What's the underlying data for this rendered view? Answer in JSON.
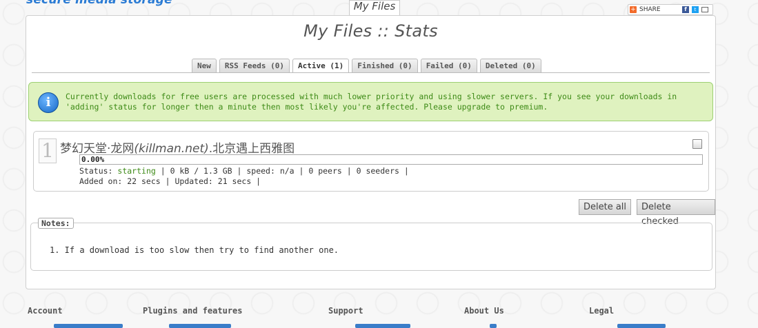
{
  "brand": {
    "tagline": "secure media storage"
  },
  "header": {
    "top_tab": "My Files",
    "share_label": "SHARE"
  },
  "page": {
    "title": "My Files :: Stats"
  },
  "tabs": [
    {
      "label": "New"
    },
    {
      "label": "RSS Feeds (0)"
    },
    {
      "label": "Active (1)"
    },
    {
      "label": "Finished (0)"
    },
    {
      "label": "Failed (0)"
    },
    {
      "label": "Deleted (0)"
    }
  ],
  "active_tab": "Active (1)",
  "notice": {
    "line1": "Currently downloads for free users are processed with much lower priority and using slower servers. If you see your downloads in",
    "line2": "'adding' status for longer then a minute then most likely you're affected. Please upgrade to premium."
  },
  "download": {
    "index": "1",
    "name_prefix": "梦幻天堂·龙网",
    "name_italic": "(killman.net)",
    "name_suffix": ".北京遇上西雅图",
    "progress_text": "0.00%",
    "progress_fraction": 0,
    "status_label": "Status:",
    "status_value": "starting",
    "status_rest": "| 0 kB / 1.3 GB | speed: n/a | 0 peers | 0 seeders |",
    "added_line": "Added on: 22 secs | Updated: 21 secs |"
  },
  "buttons": {
    "delete_all": "Delete all",
    "delete_checked": "Delete checked"
  },
  "notes": {
    "legend": "Notes:",
    "items": [
      "1.  If a download is too slow then try to find another one."
    ]
  },
  "footer": {
    "columns": [
      "Account",
      "Plugins and features",
      "Support",
      "About Us",
      "Legal"
    ]
  },
  "colors": {
    "accent": "#2a7bd4",
    "notice_bg": "#dff2bf",
    "notice_text": "#3d8a16"
  }
}
